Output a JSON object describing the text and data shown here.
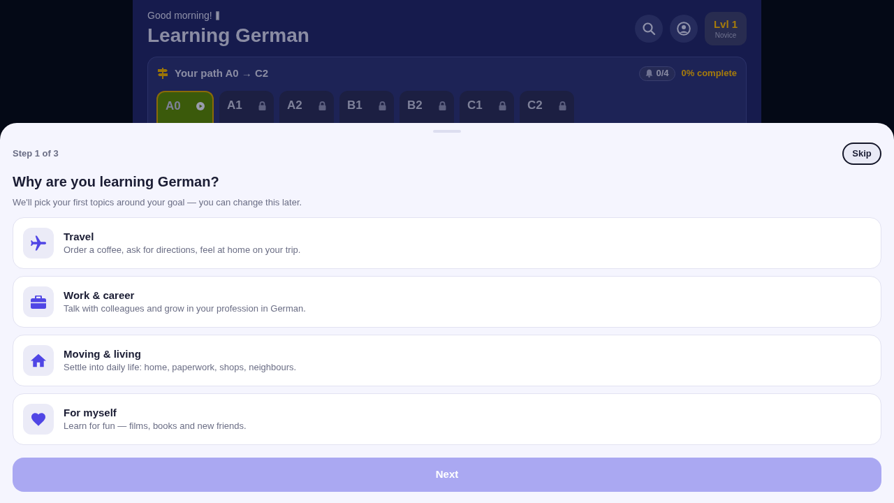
{
  "header": {
    "greeting": "Good morning!",
    "title": "Learning German",
    "badge": {
      "label": "Lvl 1",
      "sublabel": "Novice"
    }
  },
  "path": {
    "title": "Your path A0 → C2",
    "progress": "0/4",
    "completion": "0% complete",
    "stages": [
      {
        "label": "A0",
        "selected": true,
        "locked": false
      },
      {
        "label": "A1",
        "selected": false,
        "locked": true
      },
      {
        "label": "A2",
        "selected": false,
        "locked": true
      },
      {
        "label": "B1",
        "selected": false,
        "locked": true
      },
      {
        "label": "B2",
        "selected": false,
        "locked": true
      },
      {
        "label": "C1",
        "selected": false,
        "locked": true
      },
      {
        "label": "C2",
        "selected": false,
        "locked": true
      }
    ]
  },
  "sheet": {
    "step": "Step 1 of 3",
    "skip": "Skip",
    "question": "Why are you learning German?",
    "hint": "We'll pick your first topics around your goal — you can change this later.",
    "options": [
      {
        "kind": "travel",
        "title": "Travel",
        "description": "Order a coffee, ask for directions, feel at home on your trip.",
        "selected": false
      },
      {
        "kind": "work",
        "title": "Work & career",
        "description": "Talk with colleagues and grow in your profession in German.",
        "selected": false
      },
      {
        "kind": "home",
        "title": "Moving & living",
        "description": "Settle into daily life: home, paperwork, shops, neighbours.",
        "selected": false
      },
      {
        "kind": "self",
        "title": "For myself",
        "description": "Learn for fun — films, books and new friends.",
        "selected": false
      }
    ],
    "next": {
      "label": "Next",
      "disabled": true
    }
  }
}
